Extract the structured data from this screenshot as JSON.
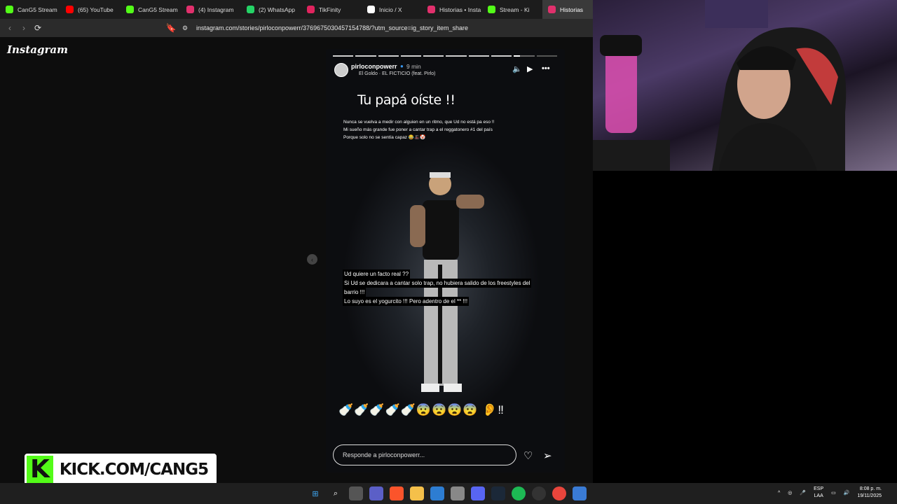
{
  "browser": {
    "tabs": [
      {
        "label": "CanG5 Stream",
        "icon": "kick-icon",
        "color": "#53fc18"
      },
      {
        "label": "(65) YouTube",
        "icon": "youtube-icon",
        "color": "#ff0000"
      },
      {
        "label": "CanG5 Stream",
        "icon": "kick-icon",
        "color": "#53fc18"
      },
      {
        "label": "(4) Instagram",
        "icon": "instagram-icon",
        "color": "#e1306c"
      },
      {
        "label": "(2) WhatsApp",
        "icon": "whatsapp-icon",
        "color": "#25d366"
      },
      {
        "label": "TikFinity",
        "icon": "tikfinity-icon",
        "color": "#e0245e"
      },
      {
        "label": "Inicio / X",
        "icon": "x-icon",
        "color": "#ffffff"
      },
      {
        "label": "Historias • Insta",
        "icon": "instagram-icon",
        "color": "#e1306c"
      },
      {
        "label": "Stream - Ki",
        "icon": "kick-icon",
        "color": "#53fc18"
      },
      {
        "label": "Historias",
        "icon": "instagram-icon",
        "color": "#e1306c"
      }
    ],
    "url": "instagram.com/stories/pirloconpowerr/3769675030457154788/?utm_source=ig_story_item_share"
  },
  "instagram": {
    "logo": "Instagram",
    "story": {
      "username": "pirloconpowerr",
      "time": "9 min",
      "song": "El Goldo · EL FICTICIO (feat. Pirlo)",
      "headline": "Tu papá oíste !!",
      "lines": [
        "Nunca se vuelva a medir con alguien en un ritmo, que Ud no está pa eso !!",
        "Mi sueño más grande fue poner a cantar trap a el reggatonero #1 del país",
        "Porque solo no se sentía capaz 😂🎩🤡"
      ],
      "caption": [
        "Ud quiere un facto real ??",
        "Si Ud se dedicara a cantar solo trap, no hubiera salido de los freestyles del",
        "barrio !!!",
        "Lo suyo es el yogurcito !!! Pero adentro de el ** !!!"
      ],
      "emojis": "🍼🍼🍼🍼🍼😨😨😨😨 👂‼",
      "reply_placeholder": "Responde a pirloconpowerr..."
    }
  },
  "overlay": {
    "kick_letter": "K",
    "kick_text": "KICK.COM/CANG5"
  },
  "taskbar": {
    "lang_top": "ESP",
    "lang_bottom": "LAA",
    "time": "8:08 p. m.",
    "date": "19/11/2025"
  }
}
